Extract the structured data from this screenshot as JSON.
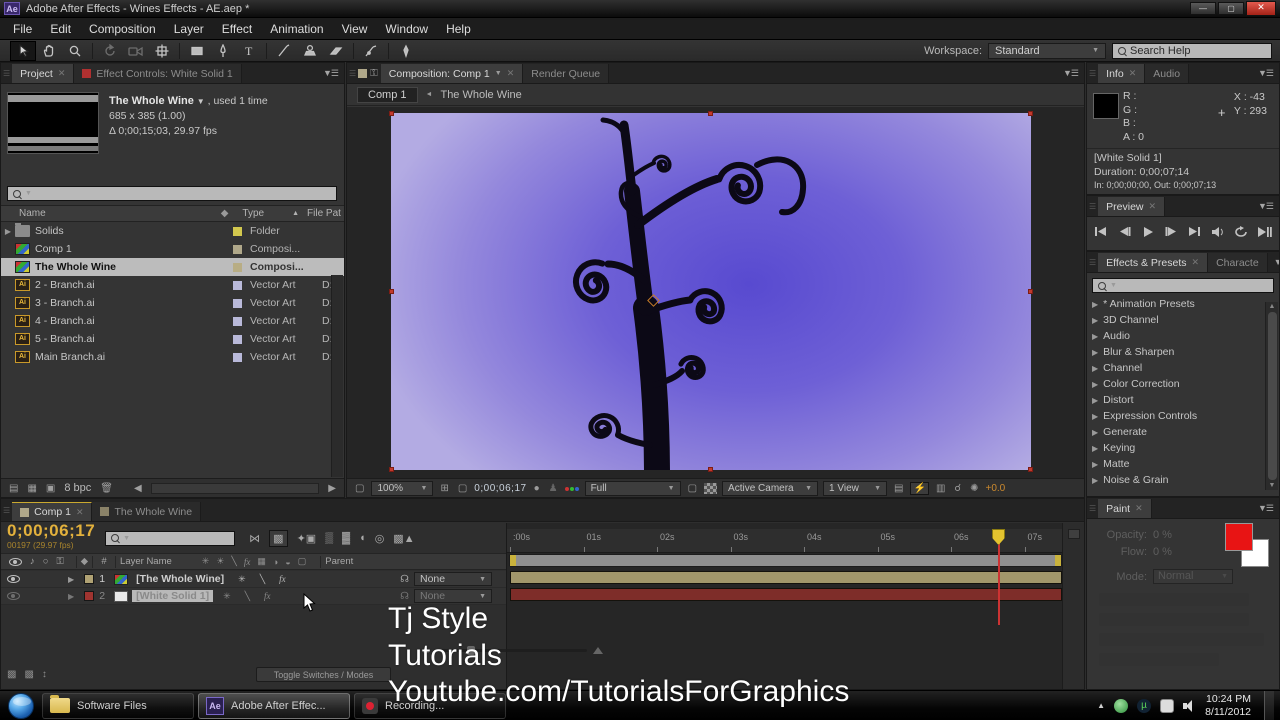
{
  "title_bar": {
    "app_icon": "Ae",
    "title": "Adobe After Effects - Wines Effects - AE.aep *"
  },
  "menu_bar": {
    "items": [
      "File",
      "Edit",
      "Composition",
      "Layer",
      "Effect",
      "Animation",
      "View",
      "Window",
      "Help"
    ]
  },
  "toolbar": {
    "workspace_label": "Workspace:",
    "workspace_value": "Standard",
    "search_placeholder": "Search Help"
  },
  "project_panel": {
    "tab": "Project",
    "tab2": "Effect Controls: White Solid 1",
    "preview_title": "The Whole Wine",
    "preview_suffix": " , used 1 time",
    "preview_dims": "685 x 385 (1.00)",
    "preview_duration": "Δ 0;00;15;03, 29.97 fps",
    "columns": {
      "name": "Name",
      "type": "Type",
      "path": "File Pat"
    },
    "items": [
      {
        "name": "Solids",
        "type": "Folder",
        "path": "",
        "swatch": "#d2c84e",
        "icon": "folder",
        "twirl": "▶"
      },
      {
        "name": "Comp 1",
        "type": "Composi...",
        "path": "",
        "swatch": "#b0a88a",
        "icon": "comp",
        "twirl": ""
      },
      {
        "name": "The Whole Wine",
        "type": "Composi...",
        "path": "",
        "swatch": "#b8ad84",
        "icon": "comp",
        "twirl": "",
        "selected": true
      },
      {
        "name": "2 - Branch.ai",
        "type": "Vector Art",
        "path": "D:",
        "swatch": "#b9b9d9",
        "icon": "ai",
        "twirl": ""
      },
      {
        "name": "3 - Branch.ai",
        "type": "Vector Art",
        "path": "D:",
        "swatch": "#b9b9d9",
        "icon": "ai",
        "twirl": ""
      },
      {
        "name": "4 - Branch.ai",
        "type": "Vector Art",
        "path": "D:",
        "swatch": "#b9b9d9",
        "icon": "ai",
        "twirl": ""
      },
      {
        "name": "5 - Branch.ai",
        "type": "Vector Art",
        "path": "D:",
        "swatch": "#b9b9d9",
        "icon": "ai",
        "twirl": ""
      },
      {
        "name": "Main Branch.ai",
        "type": "Vector Art",
        "path": "D:",
        "swatch": "#b9b9d9",
        "icon": "ai",
        "twirl": ""
      }
    ],
    "footer_bpc": "8 bpc"
  },
  "composition_panel": {
    "tab": "Composition: Comp 1",
    "tab2": "Render Queue",
    "breadcrumb_comp": "Comp 1",
    "breadcrumb_arrow": "◄",
    "breadcrumb_parent": "The Whole Wine",
    "footer": {
      "zoom": "100%",
      "time": "0;00;06;17",
      "resolution": "Full",
      "camera": "Active Camera",
      "view": "1 View",
      "exposure": "+0.0"
    }
  },
  "info_panel": {
    "tab": "Info",
    "tab2": "Audio",
    "r": "R :",
    "g": "G :",
    "b": "B :",
    "a": "A :  0",
    "x": "X : -43",
    "y": "Y : 293",
    "line1": "[White Solid 1]",
    "line2": "Duration: 0;00;07;14",
    "line3": "In: 0;00;00;00, Out: 0;00;07;13"
  },
  "preview_panel": {
    "tab": "Preview"
  },
  "effects_panel": {
    "tab": "Effects & Presets",
    "tab2": "Characte",
    "categories": [
      "* Animation Presets",
      "3D Channel",
      "Audio",
      "Blur & Sharpen",
      "Channel",
      "Color Correction",
      "Distort",
      "Expression Controls",
      "Generate",
      "Keying",
      "Matte",
      "Noise & Grain"
    ]
  },
  "paint_panel": {
    "tab": "Paint",
    "opacity_label": "Opacity:",
    "opacity_value": "0 %",
    "flow_label": "Flow:",
    "flow_value": "0 %",
    "mode_label": "Mode:",
    "mode_value": "Normal",
    "fg_color": "#e81414",
    "bg_color": "#ffffff"
  },
  "timeline": {
    "tab": "Comp 1",
    "tab2": "The Whole Wine",
    "time": "0;00;06;17",
    "frames": "00197 (29.97 fps)",
    "col_layer_name": "Layer Name",
    "col_parent": "Parent",
    "layers": [
      {
        "num": "1",
        "name": "[The Whole Wine]",
        "parent": "None",
        "bar_color": "#a2976b",
        "swatch": "#b0a274"
      },
      {
        "num": "2",
        "name": "[White Solid 1]",
        "parent": "None",
        "bar_color": "#7e2d29",
        "swatch": "#a03430",
        "selected": true
      }
    ],
    "ruler_ticks": [
      ":00s",
      "01s",
      "02s",
      "03s",
      "04s",
      "05s",
      "06s",
      "07s"
    ],
    "toggle_button": "Toggle Switches / Modes"
  },
  "overlay": {
    "lines": [
      "Tj Style",
      "Tutorials",
      "Youtube.com/TutorialsForGraphics"
    ]
  },
  "taskbar": {
    "buttons": [
      {
        "label": "Software Files"
      },
      {
        "label": "Adobe After Effec...",
        "active": true
      },
      {
        "label": "Recording..."
      }
    ],
    "clock_time": "10:24 PM",
    "clock_date": "8/11/2012"
  }
}
